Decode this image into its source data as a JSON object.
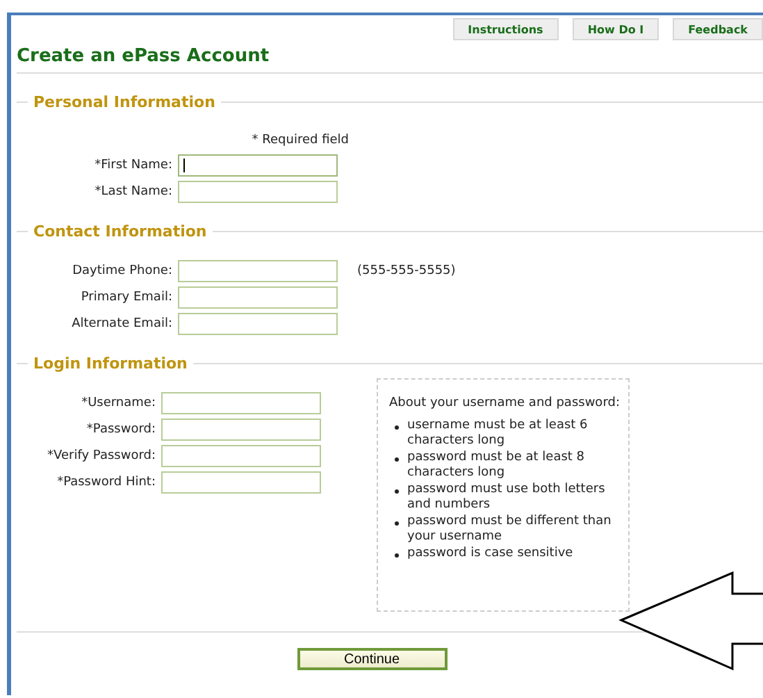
{
  "header": {
    "title": "Create an ePass Account",
    "links": [
      "Instructions",
      "How Do I",
      "Feedback"
    ]
  },
  "sections": [
    {
      "legend": "Personal Information",
      "note": "* Required field",
      "fields": [
        {
          "label": "*First Name:",
          "focused": true
        },
        {
          "label": "*Last Name:",
          "focused": false
        }
      ]
    },
    {
      "legend": "Contact Information",
      "fields": [
        {
          "label": "Daytime Phone:",
          "focused": false,
          "hint": "(555-555-5555)"
        },
        {
          "label": "Primary Email:",
          "focused": false
        },
        {
          "label": "Alternate Email:",
          "focused": false
        }
      ]
    },
    {
      "legend": "Login Information",
      "fields": [
        {
          "label": "*Username:",
          "focused": false
        },
        {
          "label": "*Password:",
          "focused": false
        },
        {
          "label": "*Verify Password:",
          "focused": false
        },
        {
          "label": "*Password Hint:",
          "focused": false
        }
      ],
      "info": {
        "heading": "About your username and password:",
        "items": [
          "username must be at least 6 characters long",
          "password must be at least 8 characters long",
          "password must use both letters and numbers",
          "password must be different than your username",
          "password is case sensitive"
        ]
      }
    }
  ],
  "continue_button": "Continue"
}
